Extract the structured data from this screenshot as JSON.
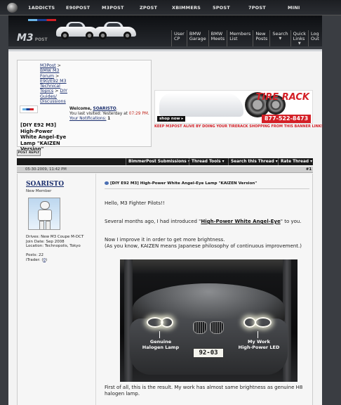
{
  "topnav": {
    "sites": [
      "1ADDICTS",
      "E90POST",
      "M3POST",
      "ZPOST",
      "XBIMMERS",
      "5POST",
      "7POST",
      "MINI"
    ]
  },
  "header": {
    "logo_text": "M3",
    "logo_sub": "POST",
    "nav": [
      {
        "label": "User CP",
        "line1": "User",
        "line2": "CP"
      },
      {
        "label": "BMW Garage",
        "line1": "BMW",
        "line2": "Garage"
      },
      {
        "label": "BMW Meets",
        "line1": "BMW",
        "line2": "Meets"
      },
      {
        "label": "Members List",
        "line1": "Members",
        "line2": "List"
      },
      {
        "label": "New Posts",
        "line1": "New",
        "line2": "Posts"
      },
      {
        "label": "Search",
        "line1": "Search",
        "line2": ""
      },
      {
        "label": "Quick Links",
        "line1": "Quick",
        "line2": "Links"
      },
      {
        "label": "Log Out",
        "line1": "Log",
        "line2": "Out"
      }
    ]
  },
  "breadcrumb": {
    "items": [
      "M3Post",
      "BMW M3 Forum",
      "E90/E92 M3 Technical Topics",
      "DIY Guides/ Discussions"
    ],
    "thread_title": "[DIY E92 M3] High-Power White Angel-Eye Lamp \"KAIZEN Version\""
  },
  "welcome": {
    "prefix": "Welcome,",
    "username": "SOARISTO",
    "visited_label": "You last visited: Yesterday at",
    "visited_time": "07:29 PM",
    "notifications_label": "Your Notifications:",
    "notifications_count": "1"
  },
  "ad": {
    "brand": "TIRE RACK",
    "phone": "877-522-8473",
    "shop_label": "shop now ▸",
    "note": "KEEP M3POST ALIVE BY DOING YOUR TIRERACK SHOPPING FROM THIS BANNER LINK!"
  },
  "post_reply_label": "POST REPLY",
  "toolbar": {
    "bimmerpost": "BimmerPost Submissions",
    "thread_tools": "Thread Tools",
    "search": "Search this Thread",
    "rate": "Rate Thread"
  },
  "post": {
    "date": "05-30-2009, 11:42 PM",
    "number": "#1",
    "author": "SOARISTO",
    "author_title": "New Member",
    "drives": "Drives: New M3 Coupe M-DCT",
    "join_date": "Join Date: Sep 2008",
    "location": "Location: Technopolis, Tokyo",
    "posts": "Posts: 22",
    "trader_prefix": "iTrader: (",
    "trader_count": "0",
    "trader_suffix": ")",
    "title": "[DIY E92 M3] High-Power White Angel-Eye Lamp \"KAIZEN Version\"",
    "greeting": "Hello, M3 Fighter Pilots!!",
    "intro_before": "Several months ago, I had introduced \"",
    "intro_link": "High-Power White Angel-Eye",
    "intro_after": "\" to you.",
    "improve_line1": "Now I improve it in order to get more brightness.",
    "improve_line2": "(As you know, KAIZEN means Japanese philosophy of continuous improvement.)",
    "photo_label_left": "Genuine\nHalogen Lamp",
    "photo_label_right": "My Work\nHigh-Power LED",
    "plate": "92-03",
    "caption": "First of all, this is the result. My work has almost same brightness as genuine H8 halogen lamp."
  }
}
